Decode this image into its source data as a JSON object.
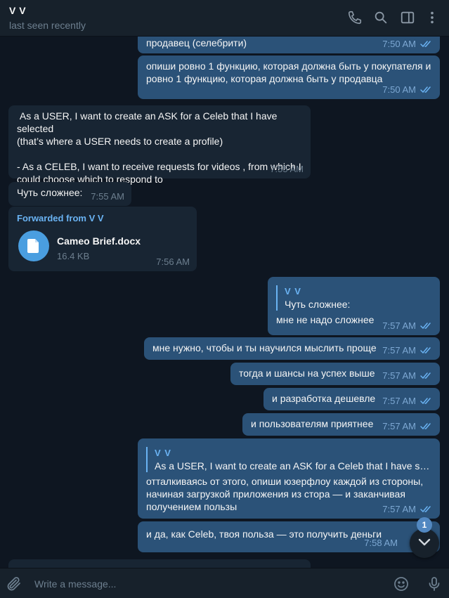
{
  "header": {
    "name": "V V",
    "status": "last seen recently"
  },
  "messages": [
    {
      "text": "продавец (селебрити)",
      "time": "7:50 AM"
    },
    {
      "text": "опиши ровно 1 функцию, которая должна быть у покупателя и\nровно 1 функцию, которая должна быть у продавца",
      "time": "7:50 AM"
    },
    {
      "text": " As a USER, I want to create an ASK for a Celeb that I have selected\n(that’s where a USER needs to create a profile)\n\n- As a CELEB, I want to receive requests for videos , from which I\ncould choose which to respond to",
      "time": "7:55 AM"
    },
    {
      "text": "Чуть сложнее:",
      "time": "7:55 AM"
    },
    {
      "forward_label": "Forwarded from V V",
      "file_name": "Cameo Brief.docx",
      "file_size": "16.4 KB",
      "time": "7:56 AM"
    },
    {
      "reply_name": "V V",
      "reply_text": "Чуть сложнее:",
      "text": "мне не надо сложнее",
      "time": "7:57 AM"
    },
    {
      "text": "мне нужно, чтобы и ты научился мыслить проще",
      "time": "7:57 AM"
    },
    {
      "text": "тогда и шансы на успех выше",
      "time": "7:57 AM"
    },
    {
      "text": "и разработка дешевле",
      "time": "7:57 AM"
    },
    {
      "text": "и пользователям приятнее",
      "time": "7:57 AM"
    },
    {
      "reply_name": "V V",
      "reply_text": "As a USER, I want to create an ASK for a Celeb that I have select...",
      "text": "отталкиваясь от этого, опиши юзерфлоу каждой из стороны,\nначиная загрузкой приложения из стора — и заканчивая\nполучением пользы",
      "time": "7:57 AM"
    },
    {
      "text": "и да, как Celeb, твоя польза — это получить деньги",
      "time": "7:58 AM"
    }
  ],
  "scroll": {
    "unread_count": "1"
  },
  "composer": {
    "placeholder": "Write a message..."
  },
  "icons": {
    "call": "phone-icon",
    "search": "search-icon",
    "sidebar": "sidebar-toggle-icon",
    "menu": "more-vertical-icon",
    "attach": "paperclip-icon",
    "emoji": "emoji-icon",
    "voice": "microphone-icon",
    "read": "double-check-icon",
    "file": "document-icon",
    "scroll": "chevron-down-icon"
  },
  "colors": {
    "background": "#0e1621",
    "panel": "#17212b",
    "outgoing": "#2b5278",
    "incoming": "#182533",
    "accent": "#6ab3f3"
  }
}
